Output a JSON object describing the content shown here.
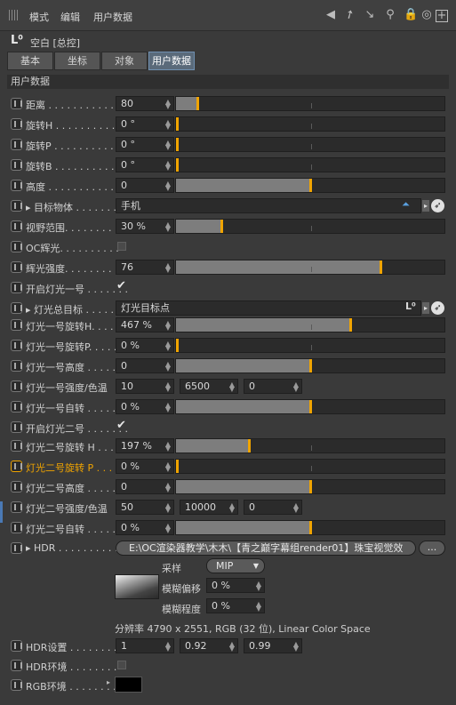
{
  "menubar": {
    "items": [
      "模式",
      "编辑",
      "用户数据"
    ],
    "icons": [
      "arrow-back-icon",
      "arrow-up-icon",
      "search-icon",
      "lock-icon",
      "target-icon",
      "add-panel-icon"
    ]
  },
  "object": {
    "title": "空白 [总控]"
  },
  "tabs": [
    {
      "label": "基本",
      "active": false
    },
    {
      "label": "坐标",
      "active": false
    },
    {
      "label": "对象",
      "active": false
    },
    {
      "label": "用户数据",
      "active": true
    }
  ],
  "section_title": "用户数据",
  "rows": [
    {
      "key": "distance",
      "label": "距离 . . . . . . . . . . . .",
      "value": "80",
      "slider": 0.08
    },
    {
      "key": "rot_h",
      "label": "旋转H . . . . . . . . . . .",
      "value": "0 °",
      "slider": 0.0
    },
    {
      "key": "rot_p",
      "label": "旋转P . . . . . . . . . . .",
      "value": "0 °",
      "slider": 0.0
    },
    {
      "key": "rot_b",
      "label": "旋转B . . . . . . . . . . .",
      "value": "0 °",
      "slider": 0.0
    },
    {
      "key": "height",
      "label": "高度 . . . . . . . . . . . .",
      "value": "0",
      "slider": 0.5
    },
    {
      "key": "target",
      "label": "目标物体 . . . . . . . . .",
      "link": "手机"
    },
    {
      "key": "fov",
      "label": "视野范围. . . . . . . . . .",
      "value": "30 %",
      "slider": 0.17
    },
    {
      "key": "oc_flare",
      "label": "OC辉光. . . . . . . . . .",
      "checked": false
    },
    {
      "key": "flare_strength",
      "label": "辉光强度. . . . . . . . .",
      "value": "76",
      "slider": 0.76
    },
    {
      "key": "light1_on",
      "label": "开启灯光一号 . . . . . . .",
      "checked": true
    },
    {
      "key": "light_target",
      "label": "灯光总目标 . . . . . . .",
      "link": "灯光目标点"
    },
    {
      "key": "l1_rot",
      "label": "灯光一号旋转H. . . . . .",
      "value": "467 %",
      "slider": 0.65
    },
    {
      "key": "l1_rotp",
      "label": "灯光一号旋转P. . . . . .",
      "value": "0 %",
      "slider": 0.0
    },
    {
      "key": "l1_height",
      "label": "灯光一号高度 . . . . . .",
      "value": "0",
      "slider": 0.5
    },
    {
      "key": "l1_strength",
      "label": "灯光一号强度/色温",
      "values": [
        "10",
        "6500",
        "0"
      ]
    },
    {
      "key": "l1_self",
      "label": "灯光一号自转 . . . . . .",
      "value": "0 %",
      "slider": 0.5
    },
    {
      "key": "light2_on",
      "label": "开启灯光二号 . . . . . . .",
      "checked": true
    },
    {
      "key": "l2_rot",
      "label": "灯光二号旋转 H . . . . .",
      "value": "197 %",
      "slider": 0.27
    },
    {
      "key": "l2_rotp",
      "label": "灯光二号旋转 P . . . . .",
      "value": "0 %",
      "slider": 0.0,
      "highlight": true
    },
    {
      "key": "l2_height",
      "label": "灯光二号高度 . . . . . .",
      "value": "0",
      "slider": 0.5
    },
    {
      "key": "l2_strength",
      "label": "灯光二号强度/色温",
      "values": [
        "50",
        "10000",
        "0"
      ]
    },
    {
      "key": "l2_self",
      "label": "灯光二号自转 . . . . . .",
      "value": "0 %",
      "slider": 0.5
    }
  ],
  "hdr": {
    "label": "HDR . . . . . . . . . . . .",
    "path": "E:\\OC渲染器教学\\木木\\【青之巅字幕组render01】珠宝视觉效",
    "browse": "...",
    "sampling_label": "采样",
    "sampling_value": "MIP",
    "blur_offset_label": "模糊偏移",
    "blur_offset_value": "0 %",
    "blur_degree_label": "模糊程度",
    "blur_degree_value": "0 %",
    "resolution": "分辨率 4790 x 2551, RGB (32 位), Linear Color Space"
  },
  "hdr_settings": {
    "label": "HDR设置 . . . . . . . .",
    "values": [
      "1",
      "0.92",
      "0.99"
    ]
  },
  "hdr_env": {
    "label": "HDR环境 . . . . . . . .",
    "checked": false
  },
  "rgb_env": {
    "label": "RGB环境 . . . . . . . .",
    "color": "#000000"
  },
  "colors": {
    "accent": "#f0a400",
    "active_tab": "#5a6a7a"
  }
}
